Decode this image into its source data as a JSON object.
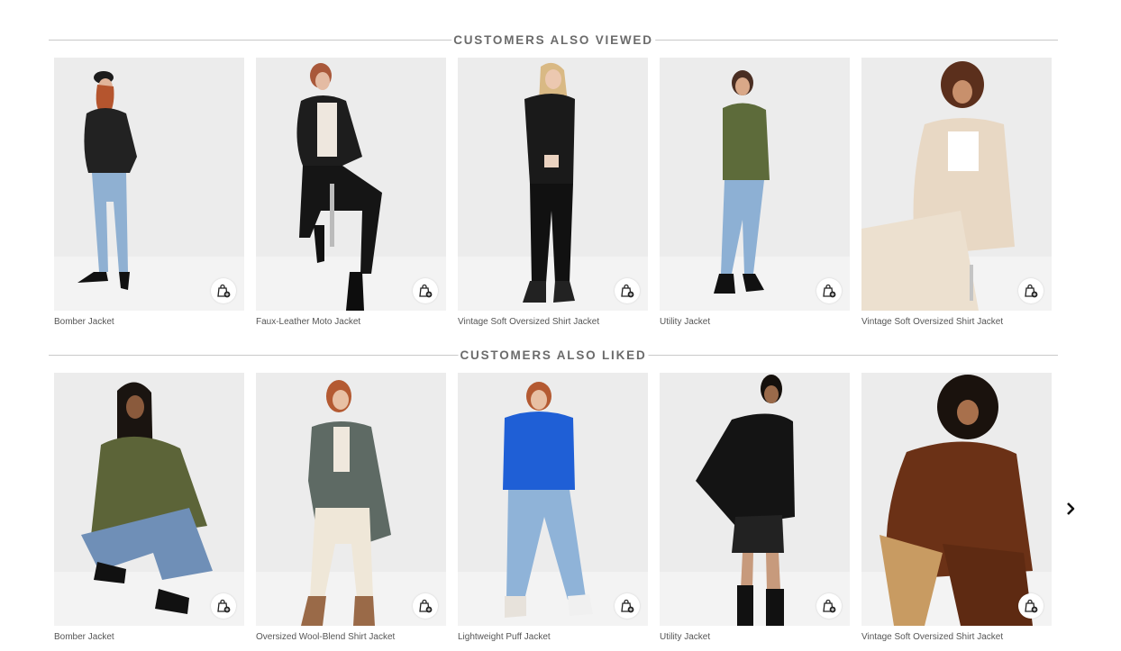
{
  "sections": [
    {
      "heading": "CUSTOMERS ALSO VIEWED",
      "products": [
        {
          "name": "Bomber Jacket",
          "icon": "add-to-bag-icon"
        },
        {
          "name": "Faux-Leather Moto Jacket",
          "icon": "add-to-bag-icon"
        },
        {
          "name": "Vintage Soft Oversized Shirt Jacket",
          "icon": "add-to-bag-icon"
        },
        {
          "name": "Utility Jacket",
          "icon": "add-to-bag-icon"
        },
        {
          "name": "Vintage Soft Oversized Shirt Jacket",
          "icon": "add-to-bag-icon"
        }
      ]
    },
    {
      "heading": "CUSTOMERS ALSO LIKED",
      "products": [
        {
          "name": "Bomber Jacket",
          "icon": "add-to-bag-icon"
        },
        {
          "name": "Oversized Wool-Blend Shirt Jacket",
          "icon": "add-to-bag-icon"
        },
        {
          "name": "Lightweight Puff Jacket",
          "icon": "add-to-bag-icon"
        },
        {
          "name": "Utility Jacket",
          "icon": "add-to-bag-icon"
        },
        {
          "name": "Vintage Soft Oversized Shirt Jacket",
          "icon": "add-to-bag-icon"
        }
      ]
    }
  ],
  "carousel": {
    "next_icon": "chevron-right-icon"
  },
  "colors": {
    "heading": "#6b6b6b",
    "divider": "#c9c9c9",
    "product_name": "#555555",
    "photo_bg": "#ececec"
  }
}
